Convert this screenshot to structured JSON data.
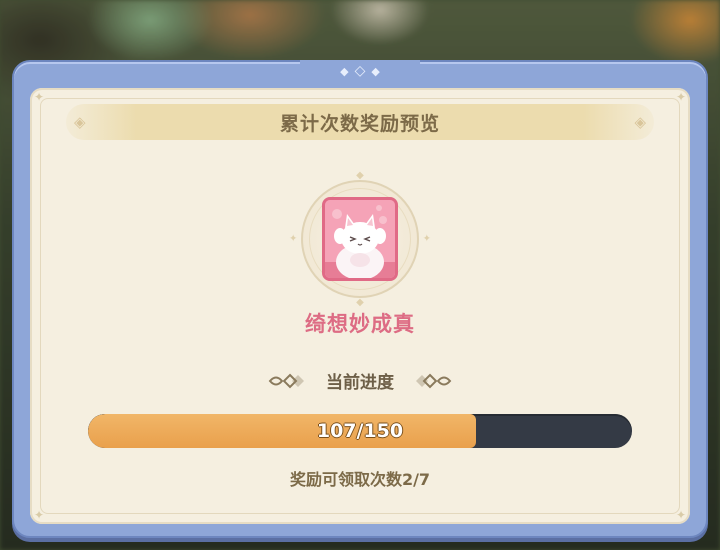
{
  "dialog": {
    "title": "累计次数奖励预览"
  },
  "reward": {
    "name": "绮想妙成真",
    "icon": "white-cat-icon",
    "card_color": "#f19ab0"
  },
  "progress": {
    "label": "当前进度",
    "current": 107,
    "total": 150,
    "text": "107/150",
    "fill_color": "#e9a04c"
  },
  "claim": {
    "text": "奖励可领取次数2/7"
  }
}
